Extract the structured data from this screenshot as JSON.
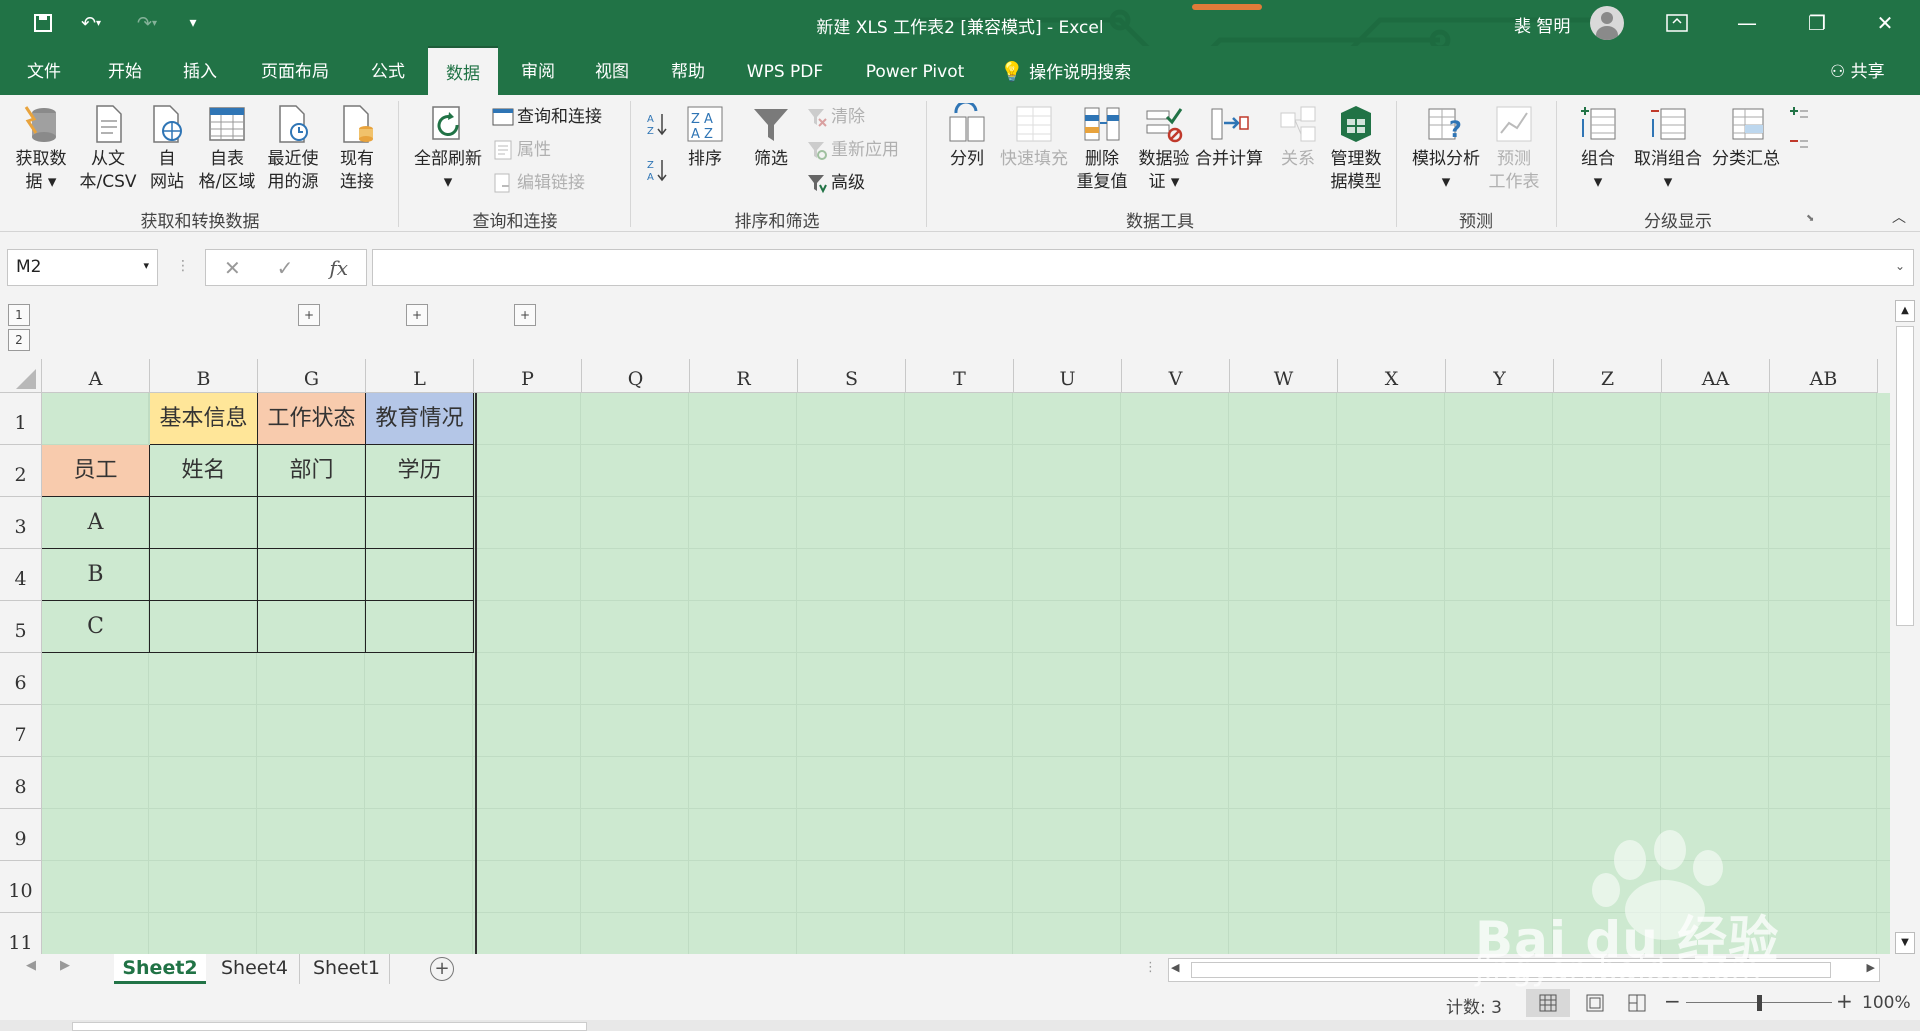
{
  "window": {
    "title": "新建 XLS 工作表2 [兼容模式] - Excel",
    "user_name": "裴 智明",
    "qat_more": "⋮"
  },
  "tabs": [
    "文件",
    "开始",
    "插入",
    "页面布局",
    "公式",
    "数据",
    "审阅",
    "视图",
    "帮助",
    "WPS PDF",
    "Power Pivot"
  ],
  "active_tab": "数据",
  "tell_me": "操作说明搜索",
  "share": "共享",
  "ribbon": {
    "groups": [
      "获取和转换数据",
      "查询和连接",
      "排序和筛选",
      "数据工具",
      "预测",
      "分级显示"
    ],
    "get_data": [
      "获取数",
      "据"
    ],
    "from_text": [
      "从文",
      "本/CSV"
    ],
    "from_web": [
      "自",
      "网站"
    ],
    "from_table": [
      "自表",
      "格/区域"
    ],
    "recent_sources": [
      "最近使",
      "用的源"
    ],
    "existing_conn": [
      "现有",
      "连接"
    ],
    "refresh_all": "全部刷新",
    "queries_conn": "查询和连接",
    "properties": "属性",
    "edit_links": "编辑链接",
    "sort": "排序",
    "filter": "筛选",
    "clear": "清除",
    "reapply": "重新应用",
    "advanced": "高级",
    "text_to_columns": "分列",
    "flash_fill": "快速填充",
    "remove_dup": [
      "删除",
      "重复值"
    ],
    "data_validation": [
      "数据验",
      "证"
    ],
    "consolidate": "合并计算",
    "relationships": "关系",
    "manage_model": [
      "管理数",
      "据模型"
    ],
    "what_if": "模拟分析",
    "forecast_sheet": [
      "预测",
      "工作表"
    ],
    "group": "组合",
    "ungroup": "取消组合",
    "subtotal": "分类汇总"
  },
  "formula_bar": {
    "name_box": "M2",
    "fx": "fx",
    "formula": ""
  },
  "outline": {
    "levels": [
      "1",
      "2"
    ],
    "expand": "+"
  },
  "columns": [
    "A",
    "B",
    "G",
    "L",
    "P",
    "Q",
    "R",
    "S",
    "T",
    "U",
    "V",
    "W",
    "X",
    "Y",
    "Z",
    "AA",
    "AB"
  ],
  "rows": [
    "1",
    "2",
    "3",
    "4",
    "5",
    "6",
    "7",
    "8",
    "9",
    "10",
    "11"
  ],
  "cells": {
    "B1": "基本信息",
    "G1": "工作状态",
    "L1": "教育情况",
    "A2": "员工",
    "B2": "姓名",
    "G2": "部门",
    "L2": "学历",
    "A3": "A",
    "A4": "B",
    "A5": "C"
  },
  "colors": {
    "title_bar": "#217346",
    "B1_fill": "#FFE699",
    "G1_fill": "#F8CBAD",
    "L1_fill": "#B4C6E7",
    "A2_fill": "#F8CBAD",
    "sheet_bg": "#CDE9D0"
  },
  "sheets": [
    "Sheet2",
    "Sheet4",
    "Sheet1"
  ],
  "active_sheet": "Sheet2",
  "status": {
    "count": "计数: 3",
    "zoom": "100%"
  },
  "watermark": {
    "text": "Bai du 经验",
    "url": "jingyan.baidu.com"
  }
}
